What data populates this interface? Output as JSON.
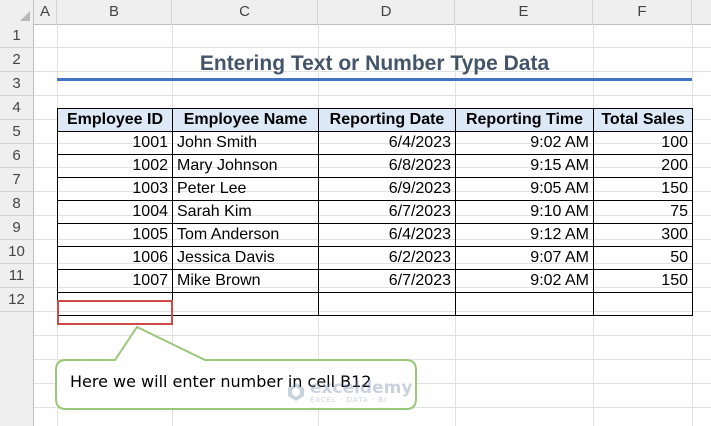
{
  "columns": [
    "A",
    "B",
    "C",
    "D",
    "E",
    "F"
  ],
  "rows": [
    "1",
    "2",
    "3",
    "4",
    "5",
    "6",
    "7",
    "8",
    "9",
    "10",
    "11",
    "12"
  ],
  "title": "Entering Text or Number Type Data",
  "table": {
    "headers": [
      "Employee ID",
      "Employee Name",
      "Reporting Date",
      "Reporting Time",
      "Total Sales"
    ],
    "rows": [
      [
        "1001",
        "John Smith",
        "6/4/2023",
        "9:02 AM",
        "100"
      ],
      [
        "1002",
        "Mary Johnson",
        "6/8/2023",
        "9:15 AM",
        "200"
      ],
      [
        "1003",
        "Peter Lee",
        "6/9/2023",
        "9:05 AM",
        "150"
      ],
      [
        "1004",
        "Sarah Kim",
        "6/7/2023",
        "9:10 AM",
        "75"
      ],
      [
        "1005",
        "Tom Anderson",
        "6/4/2023",
        "9:12 AM",
        "300"
      ],
      [
        "1006",
        "Jessica Davis",
        "6/2/2023",
        "9:07 AM",
        "50"
      ],
      [
        "1007",
        "Mike Brown",
        "6/7/2023",
        "9:02 AM",
        "150"
      ],
      [
        "",
        "",
        "",
        "",
        ""
      ]
    ]
  },
  "selected_cell": "B12",
  "callout": {
    "text": "Here we will enter number in cell B12",
    "border_color": "#9bc77a"
  },
  "watermark": {
    "name": "exceldemy",
    "tagline": "EXCEL · DATA · BI"
  },
  "colors": {
    "title": "#44546a",
    "title_rule": "#4472c4",
    "header_fill": "#dde9f7",
    "selection": "#d14a4a"
  }
}
